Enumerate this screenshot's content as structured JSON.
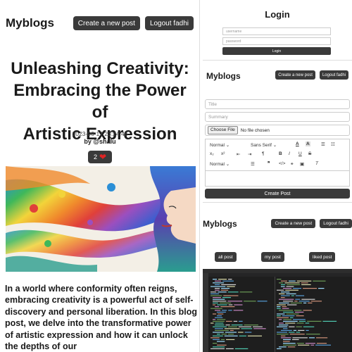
{
  "blog": {
    "brand": "Myblogs",
    "nav": {
      "create_label": "Create a new post",
      "logout_label": "Logout fadhi"
    },
    "post": {
      "title_lines": [
        "Unleashing Creativity:",
        "Embracing the Power of",
        "Artistic Expression"
      ],
      "date": "2023-06-17 23:24:46",
      "author": "by @shalu",
      "likes": "2",
      "body": "In a world where conformity often reigns, embracing creativity is a powerful act of self-discovery and personal liberation. In this blog post, we delve into the transformative power of artistic expression and how it can unlock the depths of our"
    }
  },
  "login": {
    "title": "Login",
    "username_placeholder": "username",
    "password_placeholder": "password",
    "button_label": "Login"
  },
  "create": {
    "brand": "Myblogs",
    "nav": {
      "create_label": "Create a new post",
      "logout_label": "Logout fadhi"
    },
    "title_placeholder": "Title",
    "summary_placeholder": "Summary",
    "choose_file_label": "Choose File",
    "no_file_text": "No file chosen",
    "toolbar": {
      "header_select": "Normal",
      "font_select": "Sans Serif",
      "size_select": "Normal",
      "sub_label": "x",
      "sup_label": "x",
      "bold": "B",
      "italic": "I",
      "underline": "U",
      "strike": "S",
      "quote": "❞",
      "code": "</>",
      "clear": "T"
    },
    "button_label": "Create Post"
  },
  "profile": {
    "brand": "Myblogs",
    "nav": {
      "create_label": "Create a new post",
      "logout_label": "Logout fadhi"
    },
    "tabs": [
      {
        "label": "all post"
      },
      {
        "label": "my post"
      },
      {
        "label": "liked post"
      }
    ]
  },
  "colors": {
    "dark_button": "#3a3a3a",
    "heart": "#e02424",
    "code_bg": "#1e1e1e"
  }
}
